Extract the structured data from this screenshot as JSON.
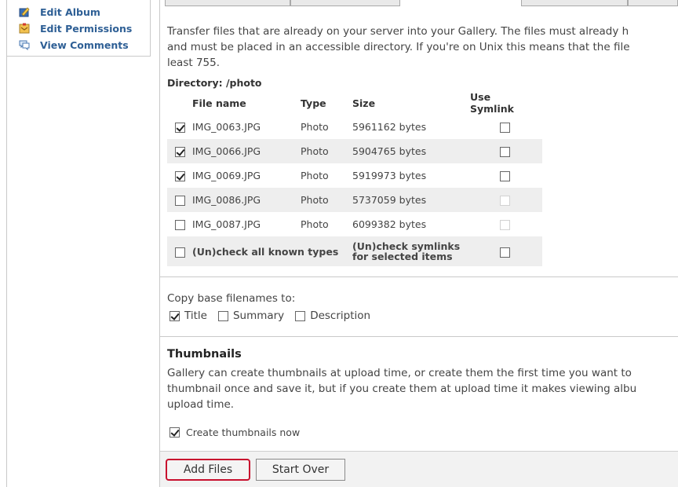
{
  "sidebar": {
    "items": [
      {
        "label": "Edit Album",
        "icon": "edit-album-icon"
      },
      {
        "label": "Edit Permissions",
        "icon": "permissions-icon"
      },
      {
        "label": "View Comments",
        "icon": "comments-icon"
      }
    ]
  },
  "intro": {
    "line1": "Transfer files that are already on your server into your Gallery. The files must already h",
    "line2": "and must be placed in an accessible directory. If you're on Unix this means that the file",
    "line3": "least 755."
  },
  "directory_label": "Directory: /photo",
  "file_table": {
    "headers": {
      "name": "File name",
      "type": "Type",
      "size": "Size",
      "symlink": "Use Symlink"
    },
    "rows": [
      {
        "name": "IMG_0063.JPG",
        "type": "Photo",
        "size": "5961162 bytes",
        "checked": true,
        "symlink_enabled": true
      },
      {
        "name": "IMG_0066.JPG",
        "type": "Photo",
        "size": "5904765 bytes",
        "checked": true,
        "symlink_enabled": true
      },
      {
        "name": "IMG_0069.JPG",
        "type": "Photo",
        "size": "5919973 bytes",
        "checked": true,
        "symlink_enabled": true
      },
      {
        "name": "IMG_0086.JPG",
        "type": "Photo",
        "size": "5737059 bytes",
        "checked": false,
        "symlink_enabled": false
      },
      {
        "name": "IMG_0087.JPG",
        "type": "Photo",
        "size": "6099382 bytes",
        "checked": false,
        "symlink_enabled": false
      }
    ],
    "check_all_label": "(Un)check all known types",
    "check_symlinks_line1": "(Un)check symlinks",
    "check_symlinks_line2": "for selected items"
  },
  "copy_filenames": {
    "label": "Copy base filenames to:",
    "options": [
      {
        "label": "Title",
        "checked": true
      },
      {
        "label": "Summary",
        "checked": false
      },
      {
        "label": "Description",
        "checked": false
      }
    ]
  },
  "thumbnails": {
    "title": "Thumbnails",
    "line1": "Gallery can create thumbnails at upload time, or create them the first time you want to",
    "line2": "thumbnail once and save it, but if you create them at upload time it makes viewing albu",
    "line3": "upload time.",
    "create_now_label": "Create thumbnails now",
    "create_now_checked": true
  },
  "buttons": {
    "add_files": "Add Files",
    "start_over": "Start Over"
  }
}
